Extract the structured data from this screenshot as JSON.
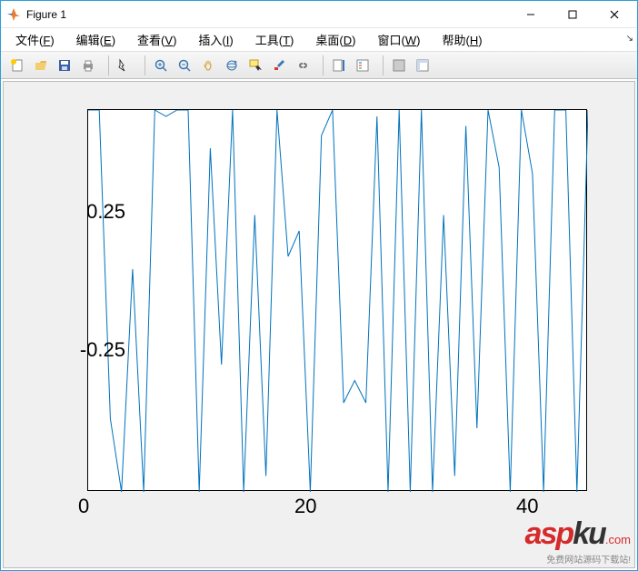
{
  "titlebar": {
    "title": "Figure 1"
  },
  "menus": {
    "file": "文件",
    "file_key": "F",
    "edit": "编辑",
    "edit_key": "E",
    "view": "查看",
    "view_key": "V",
    "insert": "插入",
    "insert_key": "I",
    "tools": "工具",
    "tools_key": "T",
    "desktop": "桌面",
    "desktop_key": "D",
    "window": "窗口",
    "window_key": "W",
    "help": "帮助",
    "help_key": "H"
  },
  "chart_data": {
    "type": "line",
    "x_range": [
      0,
      45
    ],
    "y_range": [
      -0.6,
      0.6
    ],
    "xlim_visible": [
      0,
      45
    ],
    "ylim_visible": [
      -0.6,
      0.6
    ],
    "xticks": [
      0,
      20,
      40
    ],
    "yticks": [
      -0.25,
      0.25
    ],
    "x": [
      0,
      1,
      2,
      3,
      4,
      5,
      6,
      7,
      8,
      9,
      10,
      11,
      12,
      13,
      14,
      15,
      16,
      17,
      18,
      19,
      20,
      21,
      22,
      23,
      24,
      25,
      26,
      27,
      28,
      29,
      30,
      31,
      32,
      33,
      34,
      35,
      36,
      37,
      38,
      39,
      40,
      41,
      42,
      43,
      44,
      45
    ],
    "values": [
      0.6,
      0.6,
      -0.37,
      -0.6,
      0.1,
      -0.6,
      0.6,
      0.58,
      0.6,
      0.6,
      -0.6,
      0.48,
      -0.2,
      0.6,
      -0.6,
      0.27,
      -0.55,
      0.6,
      0.14,
      0.22,
      -0.6,
      0.52,
      0.6,
      -0.32,
      -0.25,
      -0.32,
      0.58,
      -0.6,
      0.6,
      -0.6,
      0.6,
      -0.6,
      0.27,
      -0.55,
      0.55,
      -0.4,
      0.6,
      0.42,
      -0.6,
      0.6,
      0.4,
      -0.6,
      0.6,
      0.6,
      -0.6,
      0.6
    ],
    "series_color": "#0072bd",
    "title": "",
    "xlabel": "",
    "ylabel": ""
  },
  "watermark": {
    "brand_a": "asp",
    "brand_b": "ku",
    "tld": ".com",
    "sub": "免费网站源码下载站!"
  }
}
